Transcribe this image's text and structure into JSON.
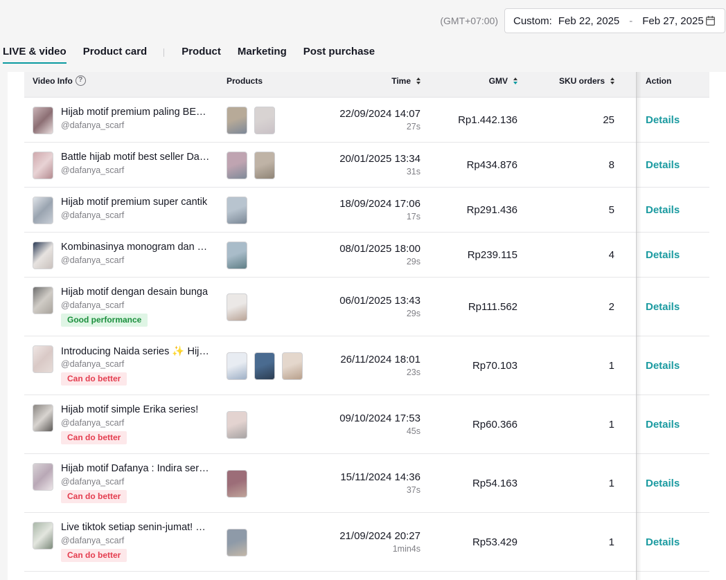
{
  "header": {
    "timezone": "(GMT+07:00)",
    "date_range": {
      "label": "Custom:",
      "start": "Feb 22, 2025",
      "separator": "-",
      "end": "Feb 27, 2025"
    }
  },
  "tabs": [
    {
      "label": "LIVE & video",
      "active": true
    },
    {
      "label": "Product card",
      "active": false
    },
    {
      "label": "Product",
      "active": false
    },
    {
      "label": "Marketing",
      "active": false
    },
    {
      "label": "Post purchase",
      "active": false
    }
  ],
  "table": {
    "columns": {
      "video_info": "Video Info",
      "products": "Products",
      "time": "Time",
      "gmv": "GMV",
      "sku_orders": "SKU orders",
      "action": "Action"
    },
    "sorted_column": "GMV",
    "rows": [
      {
        "title": "Hijab motif premium paling BESTSELLER",
        "handle": "@dafanya_scarf",
        "badge": "",
        "badge_type": "",
        "product_count": 2,
        "time": "22/09/2024 14:07",
        "duration": "27s",
        "gmv": "Rp1.442.136",
        "sku_orders": "25",
        "action": "Details"
      },
      {
        "title": "Battle hijab motif best seller Dafanya",
        "handle": "@dafanya_scarf",
        "badge": "",
        "badge_type": "",
        "product_count": 2,
        "time": "20/01/2025 13:34",
        "duration": "31s",
        "gmv": "Rp434.876",
        "sku_orders": "8",
        "action": "Details"
      },
      {
        "title": "Hijab motif premium super cantik",
        "handle": "@dafanya_scarf",
        "badge": "",
        "badge_type": "",
        "product_count": 1,
        "time": "18/09/2024 17:06",
        "duration": "17s",
        "gmv": "Rp291.436",
        "sku_orders": "5",
        "action": "Details"
      },
      {
        "title": "Kombinasinya monogram dan floral",
        "handle": "@dafanya_scarf",
        "badge": "",
        "badge_type": "",
        "product_count": 1,
        "time": "08/01/2025 18:00",
        "duration": "29s",
        "gmv": "Rp239.115",
        "sku_orders": "4",
        "action": "Details"
      },
      {
        "title": "Hijab motif dengan desain bunga",
        "handle": "@dafanya_scarf",
        "badge": "Good performance",
        "badge_type": "good",
        "product_count": 1,
        "time": "06/01/2025 13:43",
        "duration": "29s",
        "gmv": "Rp111.562",
        "sku_orders": "2",
        "action": "Details"
      },
      {
        "title": "Introducing Naida series ✨ Hijab motif",
        "handle": "@dafanya_scarf",
        "badge": "Can do better",
        "badge_type": "bad",
        "product_count": 3,
        "time": "26/11/2024 18:01",
        "duration": "23s",
        "gmv": "Rp70.103",
        "sku_orders": "1",
        "action": "Details"
      },
      {
        "title": "Hijab motif simple Erika series!",
        "handle": "@dafanya_scarf",
        "badge": "Can do better",
        "badge_type": "bad",
        "product_count": 1,
        "time": "09/10/2024 17:53",
        "duration": "45s",
        "gmv": "Rp60.366",
        "sku_orders": "1",
        "action": "Details"
      },
      {
        "title": "Hijab motif Dafanya : Indira series",
        "handle": "@dafanya_scarf",
        "badge": "Can do better",
        "badge_type": "bad",
        "product_count": 1,
        "time": "15/11/2024 14:36",
        "duration": "37s",
        "gmv": "Rp54.163",
        "sku_orders": "1",
        "action": "Details"
      },
      {
        "title": "Live tiktok setiap senin-jumat! Hijab",
        "handle": "@dafanya_scarf",
        "badge": "Can do better",
        "badge_type": "bad",
        "product_count": 1,
        "time": "21/09/2024 20:27",
        "duration": "1min4s",
        "gmv": "Rp53.429",
        "sku_orders": "1",
        "action": "Details"
      }
    ]
  },
  "colors": {
    "accent": "#0a9aa0",
    "link": "#1a9aa0",
    "good_badge_bg": "#dff5e5",
    "good_badge_text": "#1a8f3c",
    "bad_badge_bg": "#fde8ea",
    "bad_badge_text": "#e43d4f"
  },
  "icons": {
    "help": "question-circle-icon",
    "calendar": "calendar-icon",
    "sort": "sort-arrows-icon"
  }
}
